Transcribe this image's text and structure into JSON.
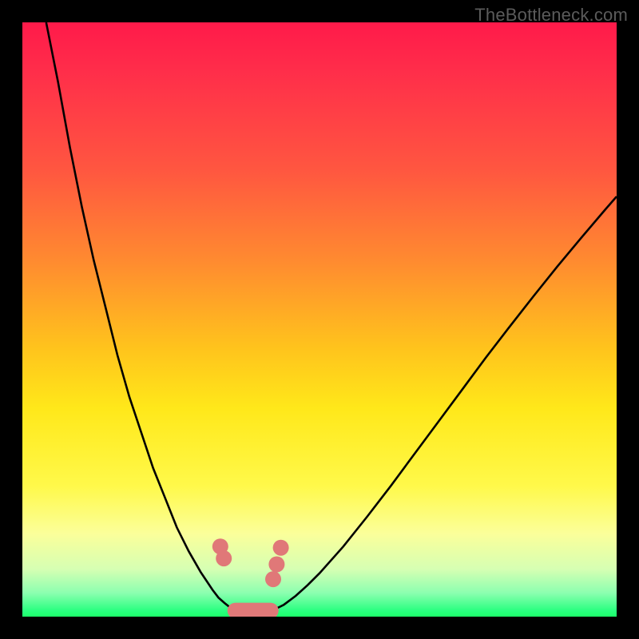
{
  "watermark": "TheBottleneck.com",
  "colors": {
    "frame": "#000000",
    "gradient_top": "#ff1a4a",
    "gradient_bottom": "#1cff69",
    "curve": "#000000",
    "marker": "#e07878"
  },
  "chart_data": {
    "type": "line",
    "title": "",
    "xlabel": "",
    "ylabel": "",
    "xlim": [
      0,
      100
    ],
    "ylim": [
      0,
      100
    ],
    "series": [
      {
        "name": "left-curve",
        "x": [
          4,
          6,
          8,
          10,
          12,
          14,
          16,
          18,
          20,
          22,
          24,
          26,
          28,
          30,
          32,
          33,
          34,
          35,
          36
        ],
        "y": [
          100,
          90,
          79,
          69,
          60,
          52,
          44,
          37,
          31,
          25,
          20,
          15,
          11,
          7.5,
          4.5,
          3.2,
          2.3,
          1.5,
          1.0
        ]
      },
      {
        "name": "right-curve",
        "x": [
          42,
          44,
          46,
          48,
          50,
          54,
          58,
          62,
          66,
          70,
          74,
          78,
          82,
          86,
          90,
          94,
          98,
          100
        ],
        "y": [
          1.0,
          2.0,
          3.5,
          5.3,
          7.3,
          11.8,
          16.8,
          22.0,
          27.4,
          32.8,
          38.2,
          43.6,
          48.8,
          53.9,
          58.9,
          63.7,
          68.4,
          70.7
        ]
      },
      {
        "name": "valley-floor",
        "x": [
          36,
          42
        ],
        "y": [
          1.0,
          1.0
        ]
      }
    ],
    "markers": {
      "left_pair_top": {
        "x": 33.3,
        "y": 11.8
      },
      "left_pair_bottom": {
        "x": 33.9,
        "y": 9.8
      },
      "right_upper": {
        "x": 43.5,
        "y": 11.6
      },
      "right_mid": {
        "x": 42.8,
        "y": 8.8
      },
      "right_lower": {
        "x": 42.2,
        "y": 6.3
      },
      "floor_pill": {
        "x_center": 38.8,
        "y": 1.0,
        "half_width_x": 4.3
      }
    }
  }
}
